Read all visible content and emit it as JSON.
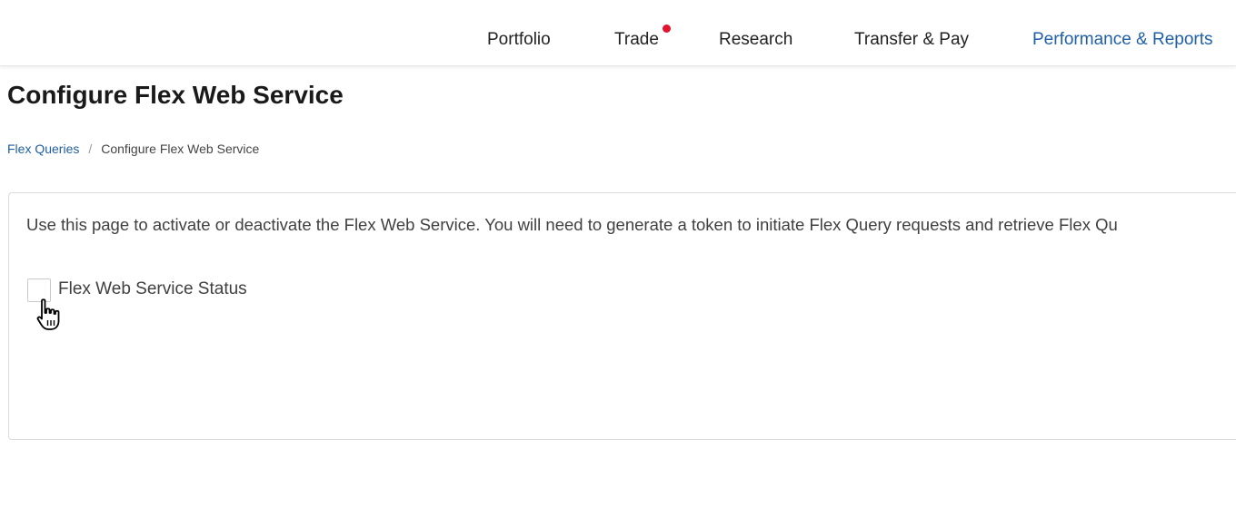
{
  "nav": {
    "items": [
      {
        "label": "Portfolio"
      },
      {
        "label": "Trade"
      },
      {
        "label": "Research"
      },
      {
        "label": "Transfer & Pay"
      },
      {
        "label": "Performance & Reports",
        "active": true
      }
    ],
    "trade_notification_color": "#e3122d",
    "active_color": "#1f5fa6"
  },
  "page": {
    "title": "Configure Flex Web Service"
  },
  "breadcrumb": {
    "parent": "Flex Queries",
    "separator": "/",
    "current": "Configure Flex Web Service"
  },
  "panel": {
    "intro": "Use this page to activate or deactivate the Flex Web Service. You will need to generate a token to initiate Flex Query requests and retrieve Flex Qu",
    "status_checkbox": {
      "label": "Flex Web Service Status",
      "checked": false
    }
  },
  "pointer": {
    "icon": "hand-pointer-icon"
  }
}
